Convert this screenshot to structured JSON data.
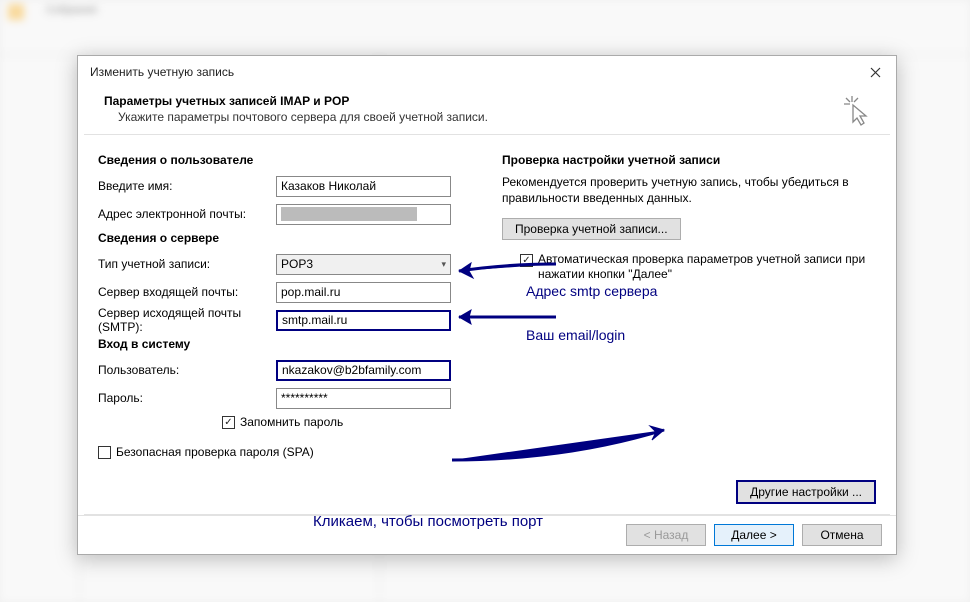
{
  "dialog": {
    "title": "Изменить учетную запись",
    "header_title": "Параметры учетных записей IMAP и POP",
    "header_subtitle": "Укажите параметры почтового сервера для своей учетной записи."
  },
  "user_info": {
    "section": "Сведения о пользователе",
    "name_label": "Введите имя:",
    "name_value": "Казаков Николай",
    "email_label": "Адрес электронной почты:",
    "email_value": "████████████████"
  },
  "server_info": {
    "section": "Сведения о сервере",
    "type_label": "Тип учетной записи:",
    "type_value": "POP3",
    "incoming_label": "Сервер входящей почты:",
    "incoming_value": "pop.mail.ru",
    "outgoing_label": "Сервер исходящей почты (SMTP):",
    "outgoing_value": "smtp.mail.ru"
  },
  "login": {
    "section": "Вход в систему",
    "user_label": "Пользователь:",
    "user_value": "nkazakov@b2bfamily.com",
    "pass_label": "Пароль:",
    "pass_value": "**********",
    "remember_label": "Запомнить пароль",
    "spa_label": "Безопасная проверка пароля (SPA)"
  },
  "test": {
    "section": "Проверка настройки учетной записи",
    "desc": "Рекомендуется проверить учетную запись, чтобы убедиться в правильности введенных данных.",
    "button": "Проверка учетной записи...",
    "autocheck_label": "Автоматическая проверка параметров учетной записи при нажатии кнопки \"Далее\""
  },
  "more_settings": "Другие настройки ...",
  "footer": {
    "back": "< Назад",
    "next": "Далее >",
    "cancel": "Отмена"
  },
  "annotations": {
    "smtp": "Адрес smtp сервера",
    "login": "Ваш email/login",
    "port": "Кликаем, чтобы посмотреть порт"
  }
}
